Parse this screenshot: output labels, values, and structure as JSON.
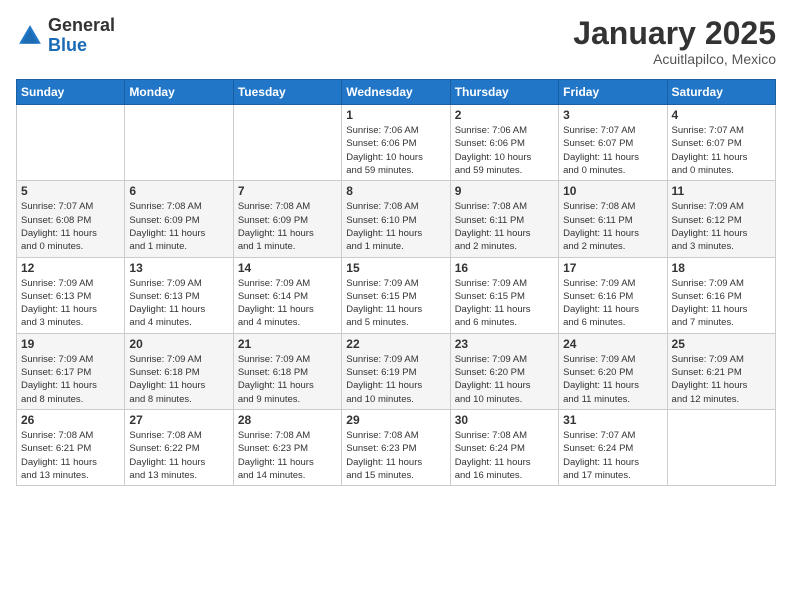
{
  "logo": {
    "general": "General",
    "blue": "Blue"
  },
  "header": {
    "month": "January 2025",
    "location": "Acuitlapilco, Mexico"
  },
  "weekdays": [
    "Sunday",
    "Monday",
    "Tuesday",
    "Wednesday",
    "Thursday",
    "Friday",
    "Saturday"
  ],
  "weeks": [
    [
      {
        "day": "",
        "info": ""
      },
      {
        "day": "",
        "info": ""
      },
      {
        "day": "",
        "info": ""
      },
      {
        "day": "1",
        "info": "Sunrise: 7:06 AM\nSunset: 6:06 PM\nDaylight: 10 hours\nand 59 minutes."
      },
      {
        "day": "2",
        "info": "Sunrise: 7:06 AM\nSunset: 6:06 PM\nDaylight: 10 hours\nand 59 minutes."
      },
      {
        "day": "3",
        "info": "Sunrise: 7:07 AM\nSunset: 6:07 PM\nDaylight: 11 hours\nand 0 minutes."
      },
      {
        "day": "4",
        "info": "Sunrise: 7:07 AM\nSunset: 6:07 PM\nDaylight: 11 hours\nand 0 minutes."
      }
    ],
    [
      {
        "day": "5",
        "info": "Sunrise: 7:07 AM\nSunset: 6:08 PM\nDaylight: 11 hours\nand 0 minutes."
      },
      {
        "day": "6",
        "info": "Sunrise: 7:08 AM\nSunset: 6:09 PM\nDaylight: 11 hours\nand 1 minute."
      },
      {
        "day": "7",
        "info": "Sunrise: 7:08 AM\nSunset: 6:09 PM\nDaylight: 11 hours\nand 1 minute."
      },
      {
        "day": "8",
        "info": "Sunrise: 7:08 AM\nSunset: 6:10 PM\nDaylight: 11 hours\nand 1 minute."
      },
      {
        "day": "9",
        "info": "Sunrise: 7:08 AM\nSunset: 6:11 PM\nDaylight: 11 hours\nand 2 minutes."
      },
      {
        "day": "10",
        "info": "Sunrise: 7:08 AM\nSunset: 6:11 PM\nDaylight: 11 hours\nand 2 minutes."
      },
      {
        "day": "11",
        "info": "Sunrise: 7:09 AM\nSunset: 6:12 PM\nDaylight: 11 hours\nand 3 minutes."
      }
    ],
    [
      {
        "day": "12",
        "info": "Sunrise: 7:09 AM\nSunset: 6:13 PM\nDaylight: 11 hours\nand 3 minutes."
      },
      {
        "day": "13",
        "info": "Sunrise: 7:09 AM\nSunset: 6:13 PM\nDaylight: 11 hours\nand 4 minutes."
      },
      {
        "day": "14",
        "info": "Sunrise: 7:09 AM\nSunset: 6:14 PM\nDaylight: 11 hours\nand 4 minutes."
      },
      {
        "day": "15",
        "info": "Sunrise: 7:09 AM\nSunset: 6:15 PM\nDaylight: 11 hours\nand 5 minutes."
      },
      {
        "day": "16",
        "info": "Sunrise: 7:09 AM\nSunset: 6:15 PM\nDaylight: 11 hours\nand 6 minutes."
      },
      {
        "day": "17",
        "info": "Sunrise: 7:09 AM\nSunset: 6:16 PM\nDaylight: 11 hours\nand 6 minutes."
      },
      {
        "day": "18",
        "info": "Sunrise: 7:09 AM\nSunset: 6:16 PM\nDaylight: 11 hours\nand 7 minutes."
      }
    ],
    [
      {
        "day": "19",
        "info": "Sunrise: 7:09 AM\nSunset: 6:17 PM\nDaylight: 11 hours\nand 8 minutes."
      },
      {
        "day": "20",
        "info": "Sunrise: 7:09 AM\nSunset: 6:18 PM\nDaylight: 11 hours\nand 8 minutes."
      },
      {
        "day": "21",
        "info": "Sunrise: 7:09 AM\nSunset: 6:18 PM\nDaylight: 11 hours\nand 9 minutes."
      },
      {
        "day": "22",
        "info": "Sunrise: 7:09 AM\nSunset: 6:19 PM\nDaylight: 11 hours\nand 10 minutes."
      },
      {
        "day": "23",
        "info": "Sunrise: 7:09 AM\nSunset: 6:20 PM\nDaylight: 11 hours\nand 10 minutes."
      },
      {
        "day": "24",
        "info": "Sunrise: 7:09 AM\nSunset: 6:20 PM\nDaylight: 11 hours\nand 11 minutes."
      },
      {
        "day": "25",
        "info": "Sunrise: 7:09 AM\nSunset: 6:21 PM\nDaylight: 11 hours\nand 12 minutes."
      }
    ],
    [
      {
        "day": "26",
        "info": "Sunrise: 7:08 AM\nSunset: 6:21 PM\nDaylight: 11 hours\nand 13 minutes."
      },
      {
        "day": "27",
        "info": "Sunrise: 7:08 AM\nSunset: 6:22 PM\nDaylight: 11 hours\nand 13 minutes."
      },
      {
        "day": "28",
        "info": "Sunrise: 7:08 AM\nSunset: 6:23 PM\nDaylight: 11 hours\nand 14 minutes."
      },
      {
        "day": "29",
        "info": "Sunrise: 7:08 AM\nSunset: 6:23 PM\nDaylight: 11 hours\nand 15 minutes."
      },
      {
        "day": "30",
        "info": "Sunrise: 7:08 AM\nSunset: 6:24 PM\nDaylight: 11 hours\nand 16 minutes."
      },
      {
        "day": "31",
        "info": "Sunrise: 7:07 AM\nSunset: 6:24 PM\nDaylight: 11 hours\nand 17 minutes."
      },
      {
        "day": "",
        "info": ""
      }
    ]
  ]
}
